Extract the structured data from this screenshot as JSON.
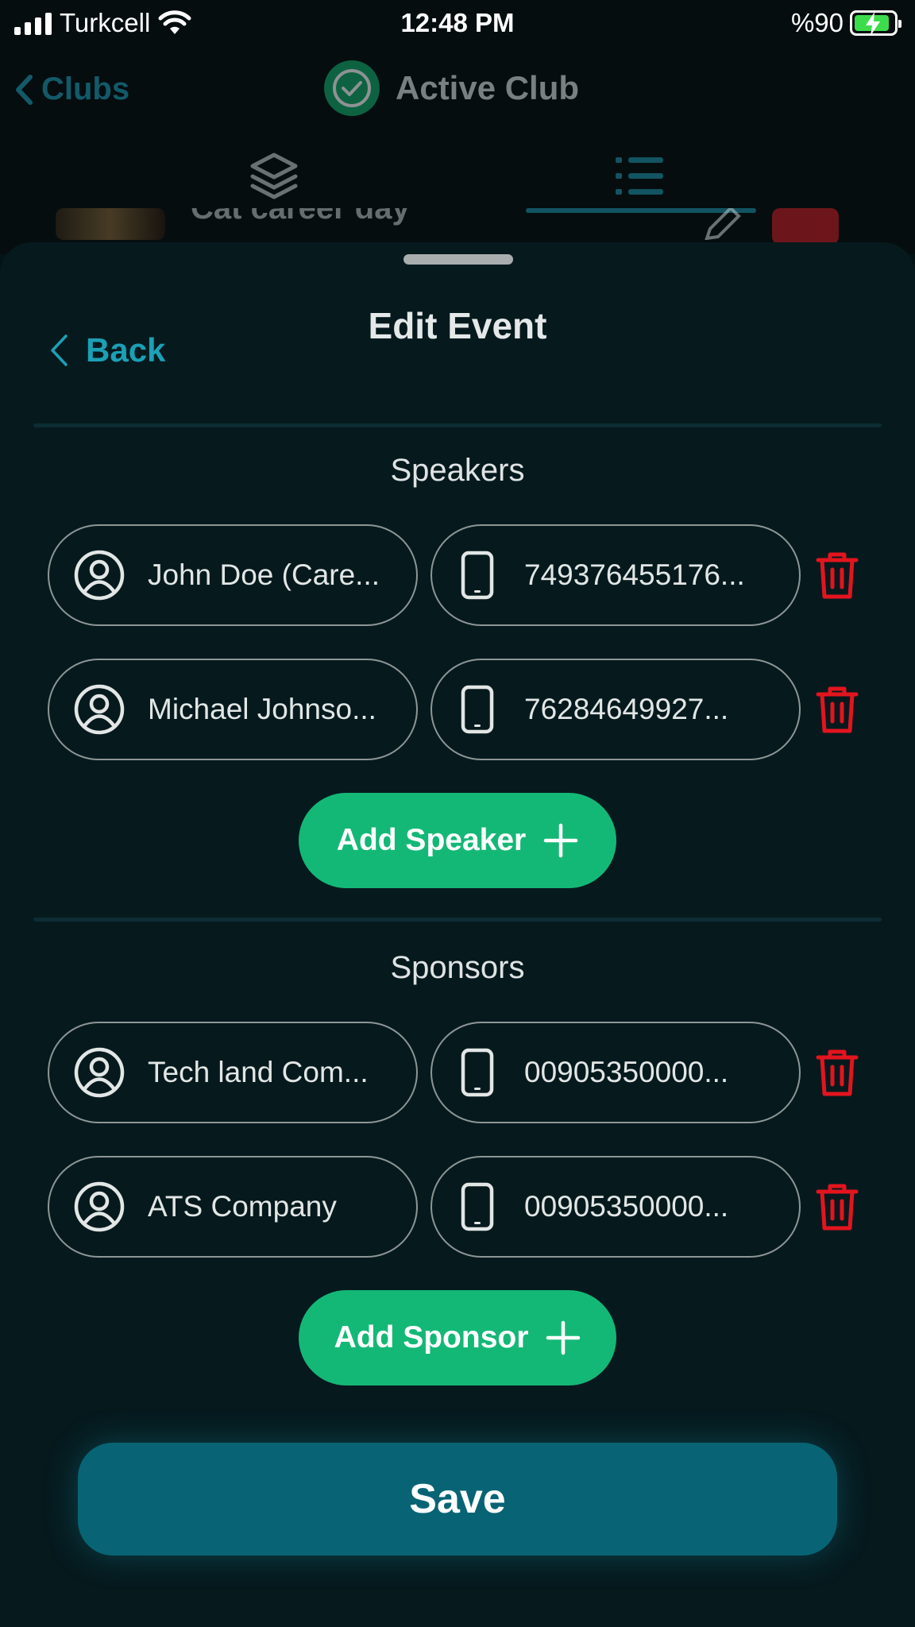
{
  "status_bar": {
    "carrier": "Turkcell",
    "time": "12:48 PM",
    "battery_percent": "%90"
  },
  "nav": {
    "back_label": "Clubs",
    "title": "Active Club"
  },
  "background_row": {
    "title_fragment": "Cat career day"
  },
  "sheet": {
    "title": "Edit Event",
    "back_label": "Back"
  },
  "speakers": {
    "section_title": "Speakers",
    "items": [
      {
        "name": "John Doe (Care...",
        "phone": "749376455176..."
      },
      {
        "name": "Michael Johnso...",
        "phone": "76284649927..."
      }
    ],
    "add_label": "Add Speaker"
  },
  "sponsors": {
    "section_title": "Sponsors",
    "items": [
      {
        "name": "Tech land Com...",
        "phone": "00905350000..."
      },
      {
        "name": "ATS Company",
        "phone": "00905350000..."
      }
    ],
    "add_label": "Add Sponsor"
  },
  "save_label": "Save",
  "colors": {
    "accent_teal": "#1ba0b6",
    "add_green": "#14b876",
    "save_teal": "#086474",
    "delete_red": "#e3141e"
  }
}
